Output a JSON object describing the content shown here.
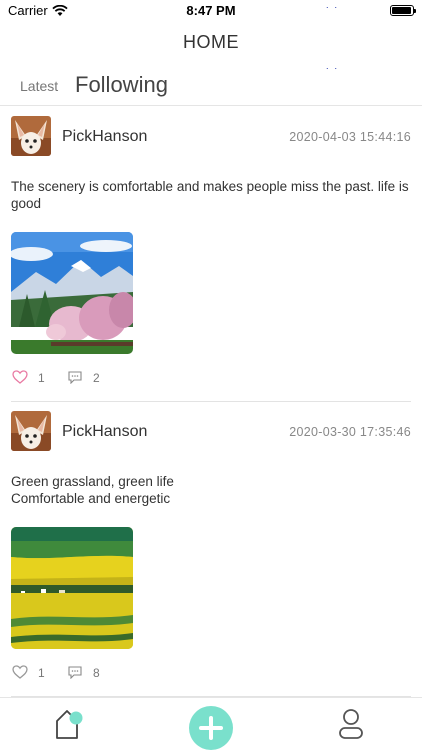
{
  "status_bar": {
    "carrier": "Carrier",
    "time": "8:47 PM",
    "battery_level": 0.95
  },
  "nav": {
    "title": "HOME"
  },
  "tabs": {
    "latest": "Latest",
    "following": "Following",
    "active": "following"
  },
  "posts": [
    {
      "username": "PickHanson",
      "time": "2020-04-03 15:44:16",
      "text": "The scenery is comfortable and makes people miss the past. life is good",
      "image": "mountain-cherry-blossom-photo",
      "likes": "1",
      "comments": "2",
      "liked": true
    },
    {
      "username": "PickHanson",
      "time": "2020-03-30 17:35:46",
      "text_line1": "Green grassland, green life",
      "text_line2": "Comfortable and energetic",
      "image": "yellow-field-grassland-photo",
      "likes": "1",
      "comments": "8",
      "liked": false
    }
  ],
  "tabbar": {
    "items": [
      "home-icon",
      "add-icon",
      "profile-icon"
    ],
    "accent": "#7ae0cc"
  }
}
